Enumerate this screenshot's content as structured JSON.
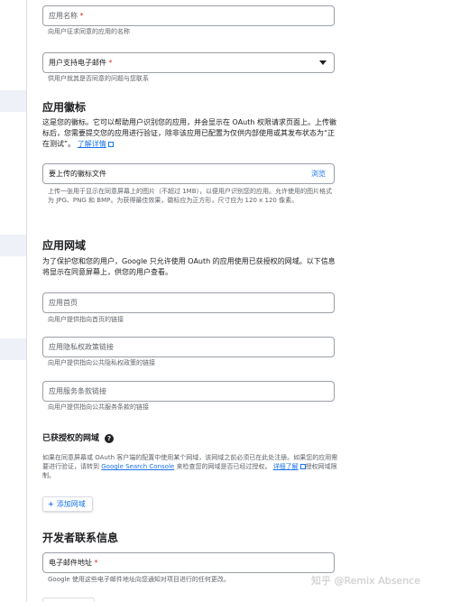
{
  "app_name": {
    "placeholder": "应用名称",
    "required_mark": "*",
    "hint": "向用户征求同意的应用的名称"
  },
  "support_email": {
    "placeholder": "用户支持电子邮件",
    "required_mark": "*",
    "hint": "供用户就其是否同意的问题与您联系"
  },
  "logo": {
    "title": "应用徽标",
    "desc": "这是您的徽标。它可以帮助用户识别您的应用，并会显示在 OAuth 权限请求页面上。上传徽标后，您需要提交您的应用进行验证，除非该应用已配置为仅供内部使用或其发布状态为“正在测试”。",
    "learn_more": "了解详情",
    "upload_placeholder": "要上传的徽标文件",
    "browse": "浏览",
    "hint": "上传一张用于显示在同意屏幕上的图片（不超过 1MB），以便用户识别您的应用。允许使用的图片格式为 JPG、PNG 和 BMP。为获得最佳效果，徽标应为正方形，尺寸应为 120 x 120 像素。"
  },
  "domain": {
    "title": "应用网域",
    "desc": "为了保护您和您的用户，Google 只允许使用 OAuth 的应用使用已获授权的网域。以下信息将显示在同意屏幕上，供您的用户查看。",
    "homepage": {
      "placeholder": "应用首页",
      "hint": "向用户提供指向首页的链接"
    },
    "privacy": {
      "placeholder": "应用隐私权政策链接",
      "hint": "向用户提供指向公共隐私权政策的链接"
    },
    "tos": {
      "placeholder": "应用服务条款链接",
      "hint": "向用户提供指向公共服务条款的链接"
    }
  },
  "authorized": {
    "title": "已获授权的网域",
    "desc_1": "如果在同意屏幕或 OAuth 客户端的配置中使用某个网域，该网域之前必须已在此处注册。如果您的应用需要进行验证，请转到",
    "console_link": "Google Search Console",
    "desc_2": "来检查您的网域是否已经过授权。",
    "learn_more": "详细了解",
    "desc_3": "授权网域限制。",
    "add_button": "添加网域"
  },
  "developer": {
    "title": "开发者联系信息",
    "email_placeholder": "电子邮件地址",
    "required_mark": "*",
    "hint": "Google 使用这些电子邮件地址向您通知对项目进行的任何更改。"
  },
  "watermark": "知乎 @Remix Absence",
  "colors": {
    "accent": "#1a73e8",
    "required": "#d93025",
    "hint": "#5f6368",
    "border": "#9aa0a6"
  },
  "icons": {
    "dropdown": "chevron-down-icon",
    "help": "help-icon",
    "external": "external-link-icon",
    "add": "plus-icon"
  }
}
